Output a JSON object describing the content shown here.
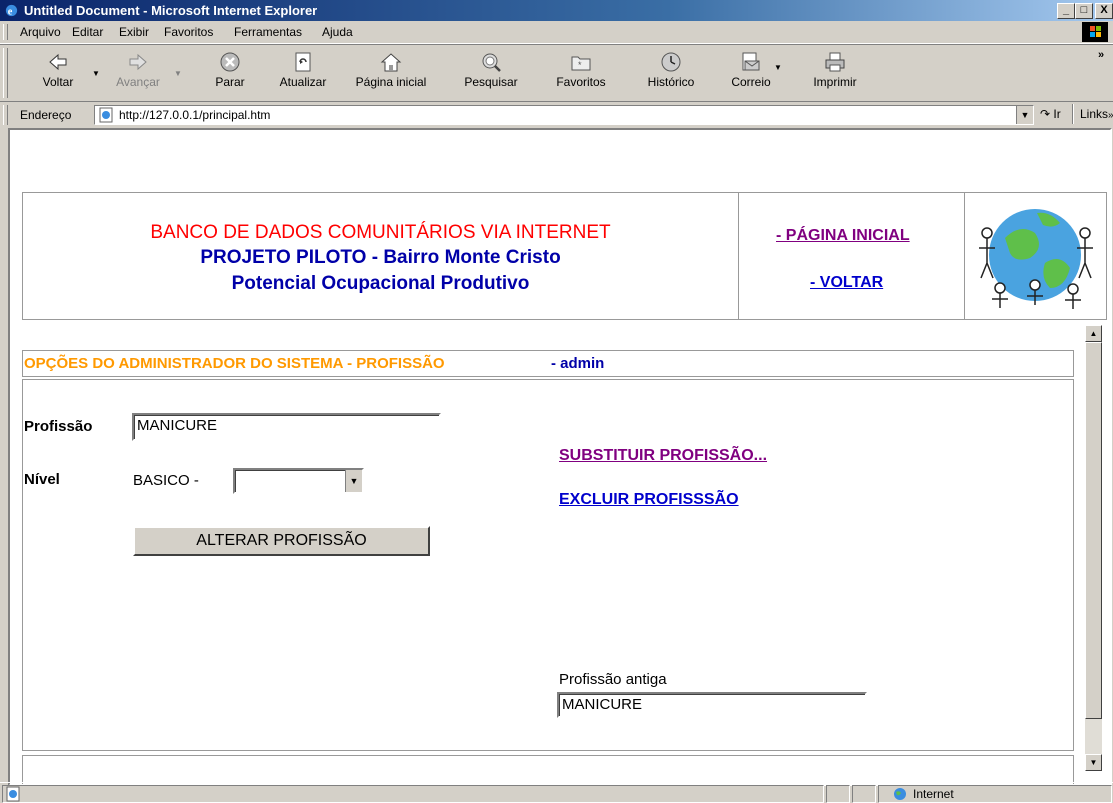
{
  "window": {
    "title": "Untitled Document - Microsoft Internet Explorer",
    "minimize": "_",
    "maximize": "□",
    "close": "X"
  },
  "menu": [
    "Arquivo",
    "Editar",
    "Exibir",
    "Favoritos",
    "Ferramentas",
    "Ajuda"
  ],
  "toolbar": {
    "back": "Voltar",
    "forward": "Avançar",
    "stop": "Parar",
    "refresh": "Atualizar",
    "home": "Página inicial",
    "search": "Pesquisar",
    "favorites": "Favoritos",
    "history": "Histórico",
    "mail": "Correio",
    "print": "Imprimir"
  },
  "address": {
    "label": "Endereço",
    "url": "http://127.0.0.1/principal.htm",
    "go": "Ir",
    "links": "Links"
  },
  "header": {
    "line1": "BANCO DE DADOS COMUNITÁRIOS VIA INTERNET",
    "line2": "PROJETO PILOTO - Bairro Monte Cristo",
    "line3": "Potencial Ocupacional Produtivo",
    "home_link": "- PÁGINA INICIAL",
    "back_link": "- VOLTAR"
  },
  "admin": {
    "section_title": "OPÇÕES DO ADMINISTRADOR DO SISTEMA - PROFISSÃO",
    "user_prefix": "- admin",
    "profissao_label": "Profissão",
    "profissao_value": "MANICURE",
    "nivel_label": "Nível",
    "nivel_text": "BASICO  -",
    "nivel_select_value": "",
    "alter_button": "ALTERAR PROFISSÃO",
    "substituir_link": "SUBSTITUIR PROFISSÃO...",
    "excluir_link": "EXCLUIR PROFISSSÃO",
    "antiga_label": "Profissão antiga",
    "antiga_value": "MANICURE"
  },
  "status": {
    "zone": "Internet"
  },
  "colors": {
    "section_title": "#ff9900",
    "admin_user": "#0000a8",
    "header_red": "#ff0000",
    "header_blue": "#0000a8"
  }
}
